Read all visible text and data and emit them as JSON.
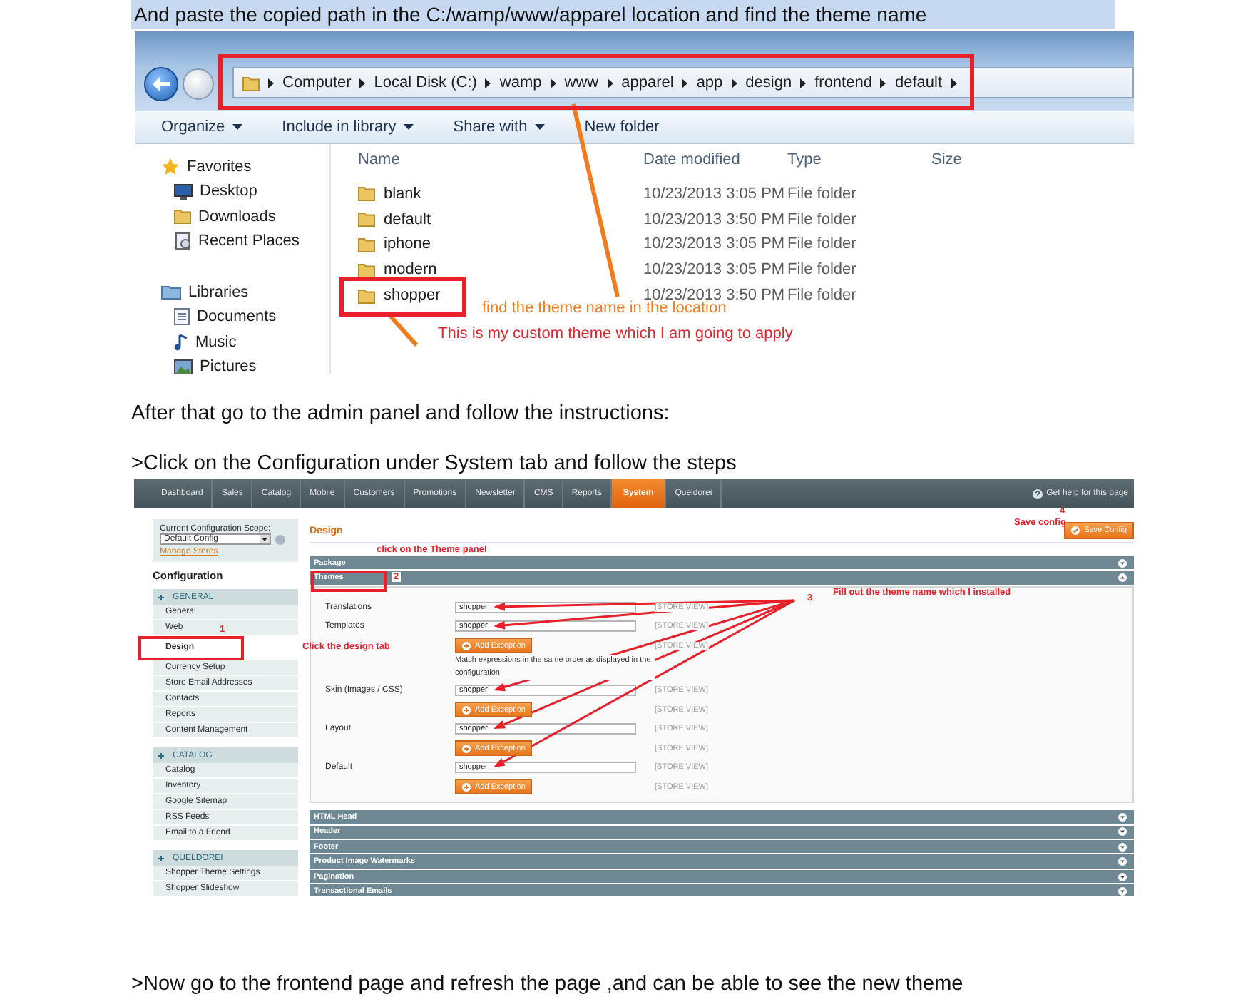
{
  "intro_line": "And paste the copied path in the C:/wamp/www/apparel location and find the theme name",
  "explorer": {
    "breadcrumb": [
      "Computer",
      "Local Disk (C:)",
      "wamp",
      "www",
      "apparel",
      "app",
      "design",
      "frontend",
      "default"
    ],
    "toolbar": [
      {
        "label": "Organize",
        "dropdown": true
      },
      {
        "label": "Include in library",
        "dropdown": true
      },
      {
        "label": "Share with",
        "dropdown": true
      },
      {
        "label": "New folder",
        "dropdown": false
      }
    ],
    "nav": [
      {
        "label": "Favorites",
        "kind": "group"
      },
      {
        "label": "Desktop",
        "kind": "item"
      },
      {
        "label": "Downloads",
        "kind": "item"
      },
      {
        "label": "Recent Places",
        "kind": "item"
      },
      {
        "label": "Libraries",
        "kind": "group"
      },
      {
        "label": "Documents",
        "kind": "item"
      },
      {
        "label": "Music",
        "kind": "item"
      },
      {
        "label": "Pictures",
        "kind": "item"
      }
    ],
    "columns": [
      "Name",
      "Date modified",
      "Type",
      "Size"
    ],
    "rows": [
      {
        "name": "blank",
        "date": "10/23/2013 3:05 PM",
        "type": "File folder"
      },
      {
        "name": "default",
        "date": "10/23/2013 3:50 PM",
        "type": "File folder"
      },
      {
        "name": "iphone",
        "date": "10/23/2013 3:05 PM",
        "type": "File folder"
      },
      {
        "name": "modern",
        "date": "10/23/2013 3:05 PM",
        "type": "File folder"
      },
      {
        "name": "shopper",
        "date": "10/23/2013 3:50 PM",
        "type": "File folder"
      }
    ],
    "notes": [
      {
        "text": "find the theme name in the location",
        "color": "#f07c1e"
      },
      {
        "text": "This is my custom theme which I am going to apply",
        "color": "#e0262c"
      }
    ]
  },
  "paragraphs": [
    "After that go to the admin panel and follow the instructions:",
    ">Click on the Configuration under System tab and follow the steps"
  ],
  "admin": {
    "nav": [
      {
        "label": "Dashboard",
        "selected": false
      },
      {
        "label": "Sales",
        "selected": false
      },
      {
        "label": "Catalog",
        "selected": false
      },
      {
        "label": "Mobile",
        "selected": false
      },
      {
        "label": "Customers",
        "selected": false
      },
      {
        "label": "Promotions",
        "selected": false
      },
      {
        "label": "Newsletter",
        "selected": false
      },
      {
        "label": "CMS",
        "selected": false
      },
      {
        "label": "Reports",
        "selected": false
      },
      {
        "label": "System",
        "selected": true
      },
      {
        "label": "Queldorei",
        "selected": false
      }
    ],
    "help": "Get help for this page",
    "scope_label": "Current Configuration Scope:",
    "scope_value": "Default Config",
    "manage_stores": "Manage Stores",
    "sidebar_title": "Configuration",
    "sections": [
      {
        "title": "GENERAL",
        "items": [
          {
            "label": "General",
            "selected": false
          },
          {
            "label": "Web",
            "selected": false
          },
          {
            "label": "Design",
            "selected": true
          },
          {
            "label": "Currency Setup",
            "selected": false
          },
          {
            "label": "Store Email Addresses",
            "selected": false
          },
          {
            "label": "Contacts",
            "selected": false
          },
          {
            "label": "Reports",
            "selected": false
          },
          {
            "label": "Content Management",
            "selected": false
          }
        ]
      },
      {
        "title": "CATALOG",
        "items": [
          {
            "label": "Catalog",
            "selected": false
          },
          {
            "label": "Inventory",
            "selected": false
          },
          {
            "label": "Google Sitemap",
            "selected": false
          },
          {
            "label": "RSS Feeds",
            "selected": false
          },
          {
            "label": "Email to a Friend",
            "selected": false
          }
        ]
      },
      {
        "title": "QUELDOREI",
        "items": [
          {
            "label": "Shopper Theme Settings",
            "selected": false
          },
          {
            "label": "Shopper Slideshow",
            "selected": false
          }
        ]
      }
    ],
    "page_title": "Design",
    "save_button": "Save Config",
    "panels_top": [
      {
        "title": "Package",
        "expanded": false
      },
      {
        "title": "Themes",
        "expanded": true
      }
    ],
    "rows": [
      {
        "kind": "field",
        "label": "Translations",
        "value": "shopper",
        "scope": "[STORE VIEW]"
      },
      {
        "kind": "field",
        "label": "Templates",
        "value": "shopper",
        "scope": "[STORE VIEW]"
      },
      {
        "kind": "exception",
        "label": "Add Exception",
        "scope": "[STORE VIEW]"
      },
      {
        "kind": "note",
        "label": "Match expressions in the same order as displayed in the configuration."
      },
      {
        "kind": "field",
        "label": "Skin (Images / CSS)",
        "value": "shopper",
        "scope": "[STORE VIEW]"
      },
      {
        "kind": "exception",
        "label": "Add Exception",
        "scope": "[STORE VIEW]"
      },
      {
        "kind": "field",
        "label": "Layout",
        "value": "shopper",
        "scope": "[STORE VIEW]"
      },
      {
        "kind": "exception",
        "label": "Add Exception",
        "scope": "[STORE VIEW]"
      },
      {
        "kind": "field",
        "label": "Default",
        "value": "shopper",
        "scope": "[STORE VIEW]"
      },
      {
        "kind": "exception",
        "label": "Add Exception",
        "scope": "[STORE VIEW]"
      }
    ],
    "panels_bottom": [
      {
        "title": "HTML Head",
        "expanded": false
      },
      {
        "title": "Header",
        "expanded": false
      },
      {
        "title": "Footer",
        "expanded": false
      },
      {
        "title": "Product Image Watermarks",
        "expanded": false
      },
      {
        "title": "Pagination",
        "expanded": false
      },
      {
        "title": "Transactional Emails",
        "expanded": false
      }
    ],
    "notes": [
      "click on the Theme panel",
      "2",
      "1",
      "Click the design tab",
      "3",
      "Fill out the theme name which I installed",
      "4",
      "Save config"
    ]
  },
  "closing_line": ">Now go to the frontend page and refresh the page ,and can be able to see the new theme"
}
